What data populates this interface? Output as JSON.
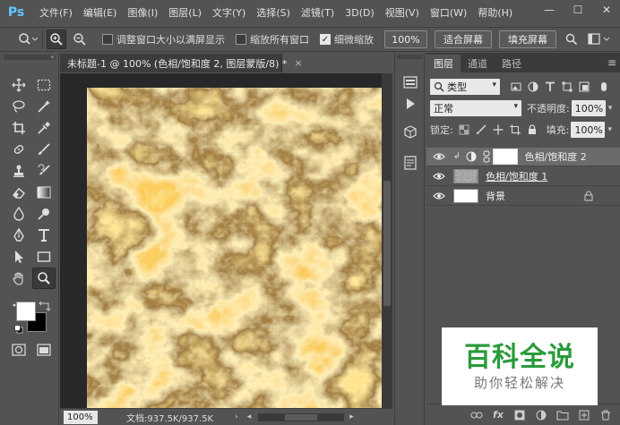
{
  "app": {
    "logo": "Ps"
  },
  "menu": [
    "文件(F)",
    "编辑(E)",
    "图像(I)",
    "图层(L)",
    "文字(Y)",
    "选择(S)",
    "滤镜(T)",
    "3D(D)",
    "视图(V)",
    "窗口(W)",
    "帮助(H)"
  ],
  "window_controls": {
    "minimize": "—",
    "maximize": "☐",
    "close": "✕"
  },
  "options": {
    "resize_windows_label": "调整窗口大小以满屏显示",
    "zoom_all_label": "缩放所有窗口",
    "scrubby_zoom_label": "细微缩放",
    "zoom_value": "100%",
    "fit_screen": "适合屏幕",
    "fill_screen": "填充屏幕"
  },
  "document": {
    "tab_title": "未标题-1 @ 100% (色相/饱和度 2, 图层蒙版/8) *",
    "zoom": "100%",
    "doc_info": "文档:937.5K/937.5K"
  },
  "layers_panel": {
    "tabs": [
      "图层",
      "通道",
      "路径"
    ],
    "filter_kind": "类型",
    "blend_mode": "正常",
    "opacity_label": "不透明度:",
    "opacity_value": "100%",
    "lock_label": "锁定:",
    "fill_label": "填充:",
    "fill_value": "100%",
    "layers": [
      {
        "name": "色相/饱和度 2",
        "selected": true
      },
      {
        "name": "色相/饱和度 1",
        "selected": false
      },
      {
        "name": "背景",
        "selected": false
      }
    ],
    "bottom_fx": "fx"
  },
  "watermark": {
    "title": "百科全说",
    "subtitle": "助你轻松解决"
  },
  "colors": {
    "accent_ps": "#5ec8ff",
    "watermark_green": "#2a9b3a",
    "canvas_gold": "#f2b43a",
    "canvas_dark": "#3a2506"
  }
}
